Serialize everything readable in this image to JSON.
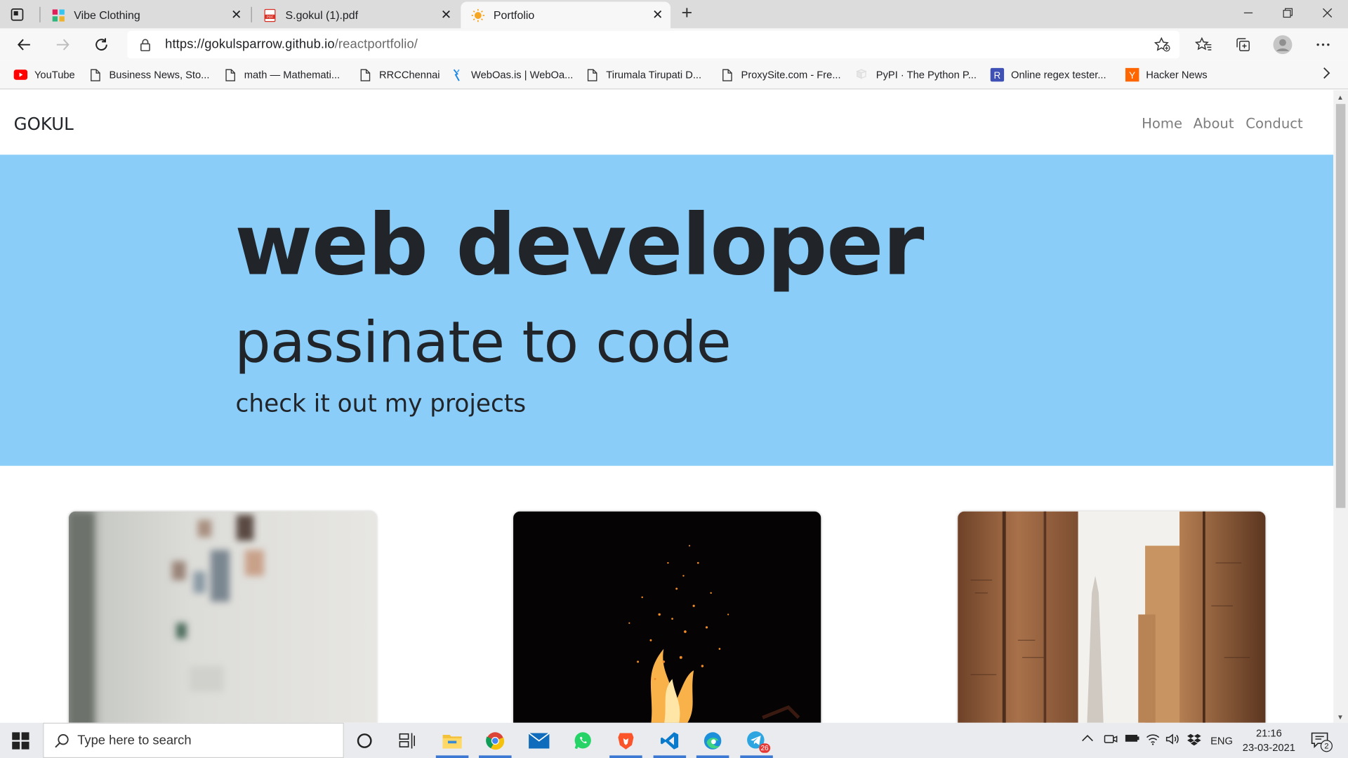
{
  "browser": {
    "tabs": [
      {
        "title": "Vibe Clothing",
        "active": false
      },
      {
        "title": "S.gokul (1).pdf",
        "active": false
      },
      {
        "title": "Portfolio",
        "active": true
      }
    ],
    "url": {
      "host": "https://gokulsparrow.github.io",
      "path": "/reactportfolio/"
    },
    "bookmarks": [
      "YouTube",
      "Business News, Sto...",
      "math — Mathemati...",
      "RRCChennai",
      "WebOas.is | WebOa...",
      "Tirumala Tirupati D...",
      "ProxySite.com - Fre...",
      "PyPI · The Python P...",
      "Online regex tester...",
      "Hacker News"
    ]
  },
  "site": {
    "brand": "GOKUL",
    "nav": [
      "Home",
      "About",
      "Conduct"
    ],
    "hero": {
      "title": "web developer",
      "subtitle": "passinate to code",
      "tagline": "check it out my projects"
    },
    "cards": [
      "workspace-photo",
      "fire-sparks-photo",
      "temple-columns-photo"
    ]
  },
  "taskbar": {
    "search_placeholder": "Type here to search",
    "language": "ENG",
    "time": "21:16",
    "date": "23-03-2021",
    "telegram_badge": "26",
    "notifications_count": "2"
  },
  "colors": {
    "hero_bg": "#89cdf8",
    "text_dark": "#212529",
    "nav_link": "#7d7d7d",
    "tab_strip": "#dcdcdc",
    "toolbar": "#f7f7f7"
  }
}
